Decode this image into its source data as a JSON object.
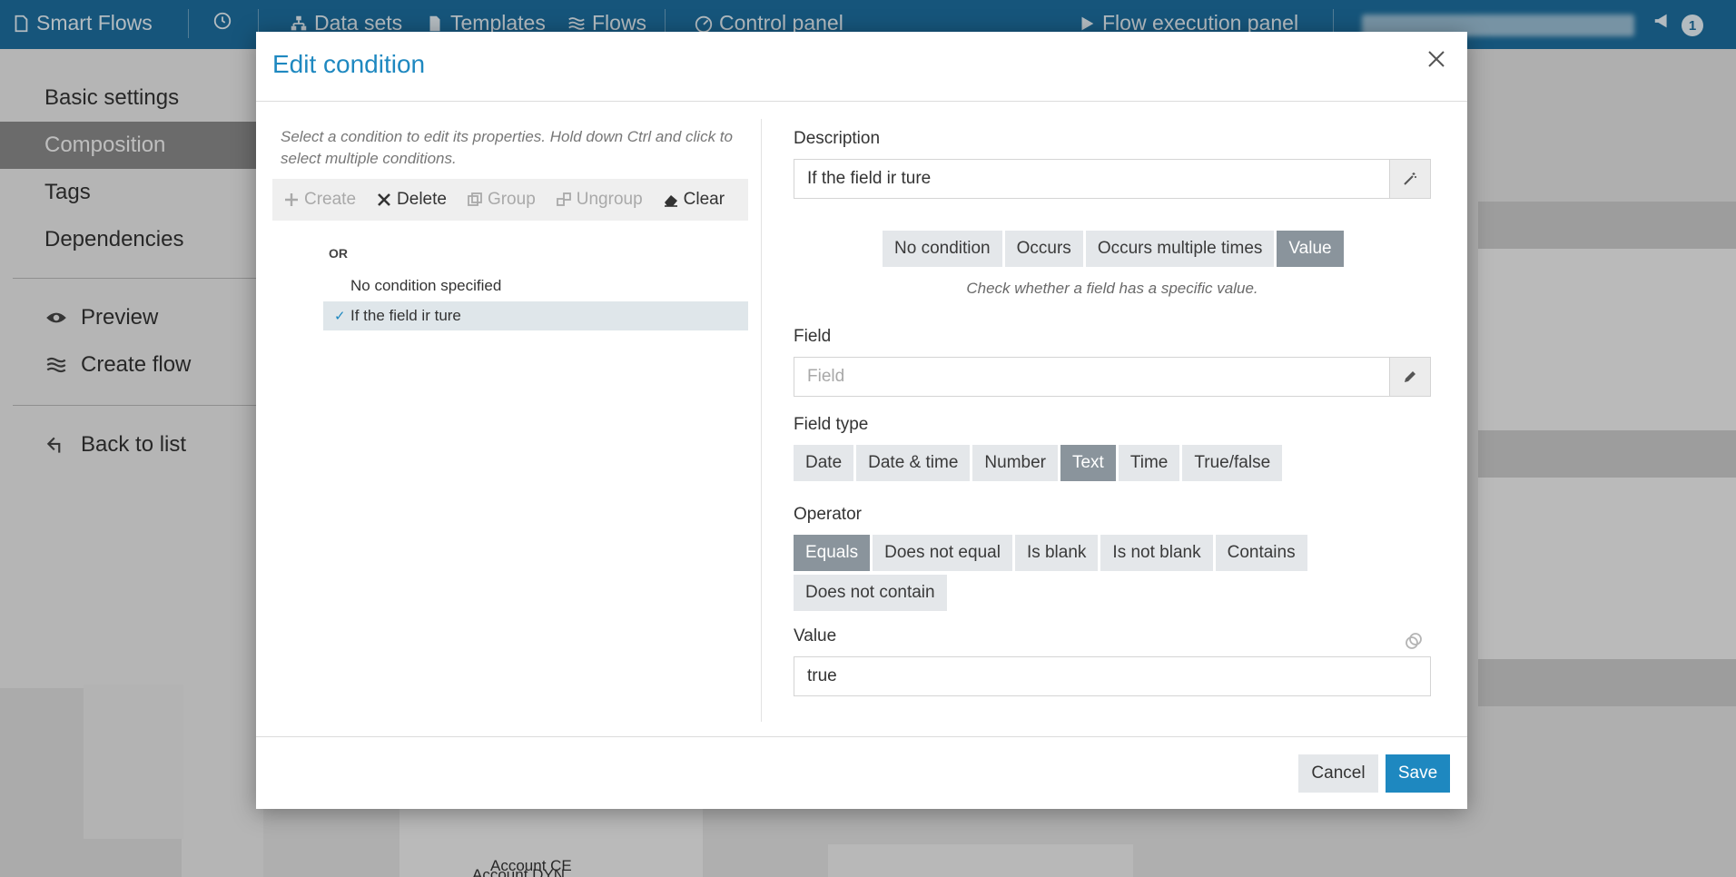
{
  "topbar": {
    "app_name": "Smart Flows",
    "nav": [
      "Data sets",
      "Templates",
      "Flows",
      "Control panel",
      "Flow execution panel"
    ],
    "notification_count": "1"
  },
  "sidebar": {
    "items": [
      {
        "label": "Basic settings"
      },
      {
        "label": "Composition"
      },
      {
        "label": "Tags"
      },
      {
        "label": "Dependencies"
      },
      {
        "label": "Preview"
      },
      {
        "label": "Create flow"
      },
      {
        "label": "Back to list"
      }
    ]
  },
  "background": {
    "list_items": [
      "Account CE",
      "Account DYN"
    ]
  },
  "dialog": {
    "title": "Edit condition",
    "hint": "Select a condition to edit its properties. Hold down Ctrl and click to select multiple conditions.",
    "toolbar": {
      "create": "Create",
      "delete": "Delete",
      "group": "Group",
      "ungroup": "Ungroup",
      "clear": "Clear"
    },
    "tree": {
      "operator": "OR",
      "items": [
        {
          "label": "No condition specified",
          "selected": false
        },
        {
          "label": "If the field ir ture",
          "selected": true
        }
      ]
    },
    "description": {
      "label": "Description",
      "value": "If the field ir ture"
    },
    "condition_types": {
      "options": [
        "No condition",
        "Occurs",
        "Occurs multiple times",
        "Value"
      ],
      "selected": "Value",
      "hint": "Check whether a field has a specific value."
    },
    "field": {
      "label": "Field",
      "placeholder": "Field"
    },
    "field_type": {
      "label": "Field type",
      "options": [
        "Date",
        "Date & time",
        "Number",
        "Text",
        "Time",
        "True/false"
      ],
      "selected": "Text"
    },
    "operator": {
      "label": "Operator",
      "options": [
        "Equals",
        "Does not equal",
        "Is blank",
        "Is not blank",
        "Contains",
        "Does not contain"
      ],
      "selected": "Equals"
    },
    "value": {
      "label": "Value",
      "value": "true"
    },
    "buttons": {
      "cancel": "Cancel",
      "save": "Save"
    }
  },
  "colors": {
    "accent": "#1e88c0",
    "topbar": "#1d6e9e",
    "segment_active": "#8a949c"
  }
}
